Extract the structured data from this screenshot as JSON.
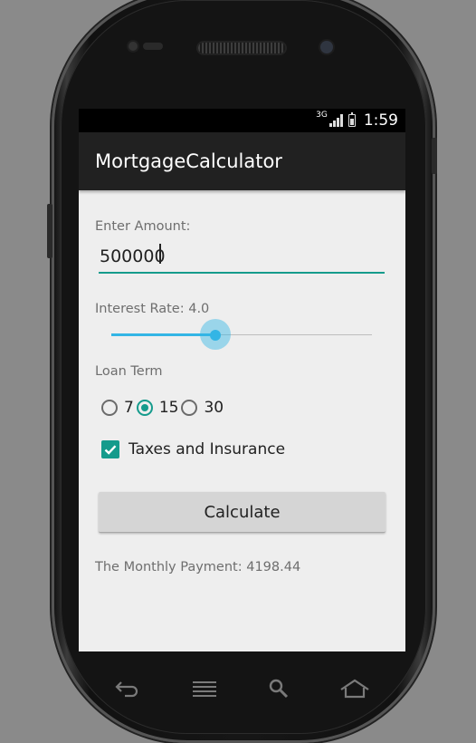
{
  "status_bar": {
    "network": "3G",
    "time": "1:59"
  },
  "app": {
    "title": "MortgageCalculator"
  },
  "amount": {
    "label": "Enter Amount:",
    "value": "500000"
  },
  "interest": {
    "label": "Interest Rate: 4.0",
    "rate": 4.0,
    "slider_fraction": 0.4
  },
  "loan_term": {
    "label": "Loan Term",
    "options": [
      {
        "label": "7",
        "checked": false
      },
      {
        "label": "15",
        "checked": true
      },
      {
        "label": "30",
        "checked": false
      }
    ]
  },
  "taxes": {
    "label": "Taxes and Insurance",
    "checked": true
  },
  "calculate": {
    "label": "Calculate"
  },
  "result": {
    "text": "The Monthly Payment: 4198.44"
  },
  "nav_buttons": [
    "back-icon",
    "menu-icon",
    "search-icon",
    "home-icon"
  ],
  "colors": {
    "accent": "#159b8c",
    "slider": "#33b5e5",
    "action_bar": "#212121",
    "background": "#eeeeee"
  }
}
